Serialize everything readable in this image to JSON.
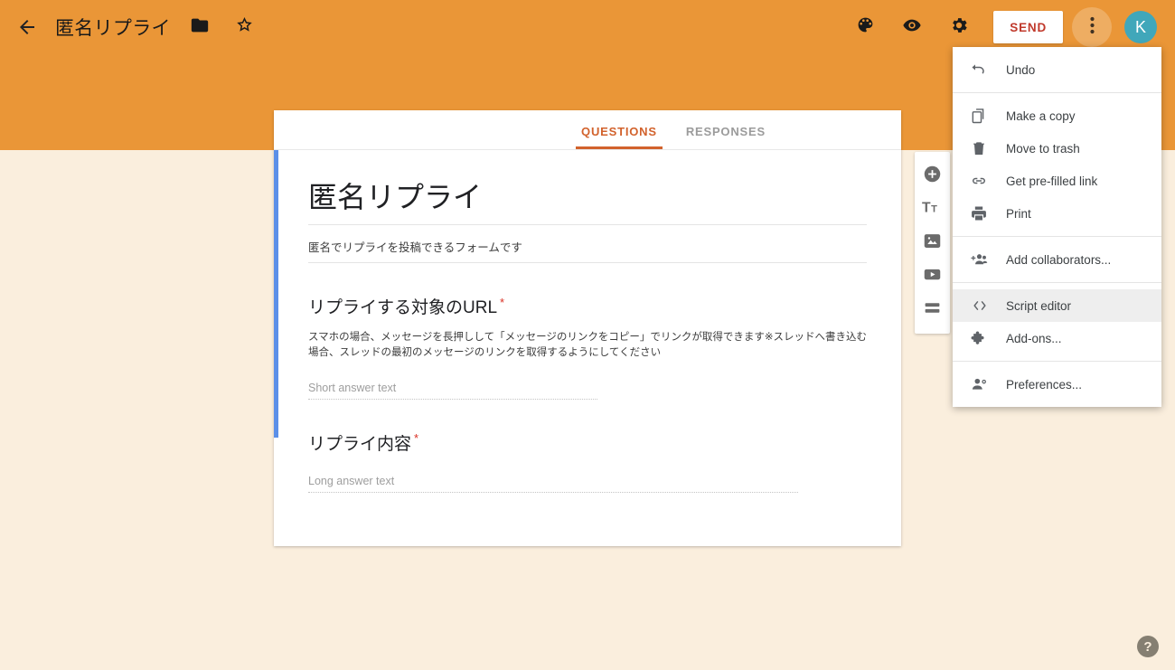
{
  "header": {
    "back_icon": "arrow-back-icon",
    "doc_title": "匿名リプライ",
    "folder_icon": "folder-icon",
    "star_icon": "star-outline-icon",
    "palette_icon": "palette-icon",
    "preview_icon": "eye-preview-icon",
    "settings_icon": "gear-settings-icon",
    "send_label": "SEND",
    "more_icon": "more-vert-icon",
    "avatar_initial": "K",
    "bg_color": "#ea9637",
    "send_text_color": "#c0392b",
    "avatar_color": "#40a7ba"
  },
  "tabs": [
    {
      "label": "QUESTIONS",
      "active": true
    },
    {
      "label": "RESPONSES",
      "active": false
    }
  ],
  "form": {
    "title": "匿名リプライ",
    "description": "匿名でリプライを投稿できるフォームです",
    "accent_rail_color": "#5b8fe8",
    "questions": [
      {
        "title": "リプライする対象のURL",
        "required": true,
        "required_marker": "*",
        "help": "スマホの場合、メッセージを長押しして「メッセージのリンクをコピー」でリンクが取得できます※スレッドへ書き込む場合、スレッドの最初のメッセージのリンクを取得するようにしてください",
        "answer_placeholder": "Short answer text",
        "answer_type": "short"
      },
      {
        "title": "リプライ内容",
        "required": true,
        "required_marker": "*",
        "help": "",
        "answer_placeholder": "Long answer text",
        "answer_type": "long"
      }
    ]
  },
  "side_toolbar": {
    "items": [
      {
        "icon": "add-circle-icon",
        "name": "add-question"
      },
      {
        "icon": "title-text-icon",
        "name": "add-title-and-description"
      },
      {
        "icon": "image-icon",
        "name": "add-image"
      },
      {
        "icon": "video-icon",
        "name": "add-video"
      },
      {
        "icon": "section-icon",
        "name": "add-section"
      }
    ]
  },
  "menu": {
    "items": [
      {
        "label": "Undo",
        "icon": "undo-icon",
        "hover": false,
        "separator_after": true
      },
      {
        "label": "Make a copy",
        "icon": "copy-icon",
        "hover": false,
        "separator_after": false
      },
      {
        "label": "Move to trash",
        "icon": "trash-icon",
        "hover": false,
        "separator_after": false
      },
      {
        "label": "Get pre-filled link",
        "icon": "link-icon",
        "hover": false,
        "separator_after": false
      },
      {
        "label": "Print",
        "icon": "print-icon",
        "hover": false,
        "separator_after": true
      },
      {
        "label": "Add collaborators...",
        "icon": "add-people-icon",
        "hover": false,
        "separator_after": true
      },
      {
        "label": "Script editor",
        "icon": "code-brackets-icon",
        "hover": true,
        "separator_after": false
      },
      {
        "label": "Add-ons...",
        "icon": "puzzle-piece-icon",
        "hover": false,
        "separator_after": true
      },
      {
        "label": "Preferences...",
        "icon": "person-settings-icon",
        "hover": false,
        "separator_after": false
      }
    ]
  },
  "help": {
    "label": "?",
    "icon": "help-circle-icon"
  }
}
